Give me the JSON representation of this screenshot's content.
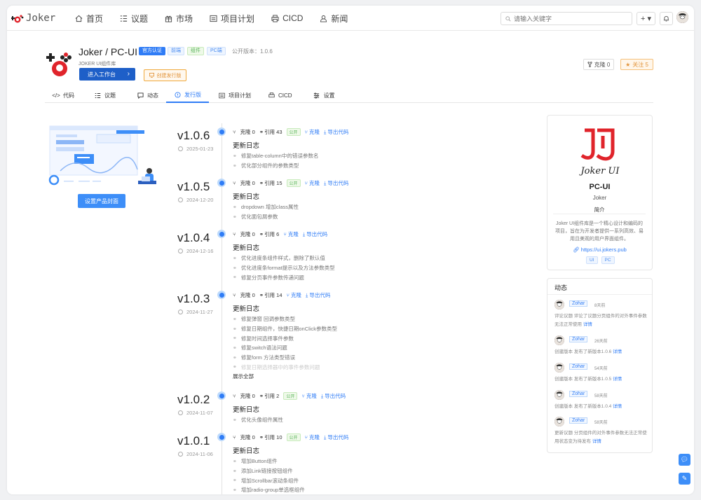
{
  "app": {
    "name": "Joker"
  },
  "nav": {
    "items": [
      {
        "label": "首页",
        "icon": "home-icon"
      },
      {
        "label": "议题",
        "icon": "list-icon"
      },
      {
        "label": "市场",
        "icon": "gift-icon"
      },
      {
        "label": "项目计划",
        "icon": "calendar-icon"
      },
      {
        "label": "CICD",
        "icon": "printer-icon"
      },
      {
        "label": "新闻",
        "icon": "user-icon"
      }
    ],
    "search_placeholder": "请输入关键字",
    "plus_label": "+ ▾"
  },
  "repo": {
    "owner": "Joker",
    "sep": " / ",
    "name": "PC-UI",
    "tags": [
      "官方认证",
      "前端",
      "组件",
      "PC端"
    ],
    "public_version": "公开版本：1.0.6",
    "subtitle": "JOKER UI组件库",
    "enter_label": "进入工作台",
    "create_release_label": "创建发行版",
    "clone_label": "克隆 0",
    "star_label": "关注 5"
  },
  "tabs": [
    {
      "label": "代码",
      "icon": "code-icon"
    },
    {
      "label": "议题",
      "icon": "list-icon"
    },
    {
      "label": "动态",
      "icon": "message-icon"
    },
    {
      "label": "发行版",
      "icon": "info-icon",
      "active": true
    },
    {
      "label": "项目计划",
      "icon": "calendar-icon"
    },
    {
      "label": "CICD",
      "icon": "printer-icon"
    },
    {
      "label": "设置",
      "icon": "sliders-icon"
    }
  ],
  "set_cover_label": "设置产品封面",
  "changelog_title": "更新日志",
  "show_all_label": "展示全部",
  "releases": [
    {
      "version": "v1.0.6",
      "date": "2025-01-23",
      "clone": "克隆 0",
      "refs": "引用 43",
      "public": "公开",
      "clone_link": "克隆",
      "export": "导出代码",
      "items": [
        "修复table-column中的错误参数名",
        "优化部分组件的参数类型"
      ]
    },
    {
      "version": "v1.0.5",
      "date": "2024-12-20",
      "clone": "克隆 0",
      "refs": "引用 15",
      "public": "公开",
      "clone_link": "克隆",
      "export": "导出代码",
      "items": [
        "dropdown 增加class属性",
        "优化面包屑参数"
      ]
    },
    {
      "version": "v1.0.4",
      "date": "2024-12-16",
      "clone": "克隆 0",
      "refs": "引用 6",
      "public": "",
      "clone_link": "克隆",
      "export": "导出代码",
      "items": [
        "优化进度条组件样式，删除了默认值",
        "优化进度条format提示以及方法参数类型",
        "修复分页事件参数传递问题"
      ]
    },
    {
      "version": "v1.0.3",
      "date": "2024-11-27",
      "clone": "克隆 0",
      "refs": "引用 14",
      "public": "",
      "clone_link": "克隆",
      "export": "导出代码",
      "items": [
        "修复弹窗 回调参数类型",
        "修复日期组件，快捷日期onClick参数类型",
        "修复时间选择事件参数",
        "修复switch语法问题",
        "修复form 方法类型错误",
        "修复日期选择器中的事件参数问题"
      ]
    },
    {
      "version": "v1.0.2",
      "date": "2024-11-07",
      "clone": "克隆 0",
      "refs": "引用 2",
      "public": "公开",
      "clone_link": "克隆",
      "export": "导出代码",
      "items": [
        "优化头像组件属性"
      ]
    },
    {
      "version": "v1.0.1",
      "date": "2024-11-06",
      "clone": "克隆 0",
      "refs": "引用 10",
      "public": "公开",
      "clone_link": "克隆",
      "export": "导出代码",
      "items": [
        "增加Button组件",
        "添加Link链接按钮组件",
        "增加Scrollbar滚动条组件",
        "增加radio-group单选框组件"
      ]
    }
  ],
  "product": {
    "logo_text": "Joker UI",
    "name": "PC-UI",
    "owner": "Joker",
    "section": "简介",
    "description": "Joker UI组件库是一个精心设计和编码的项目，旨在为开发者提供一系列高效、易用且美观的用户界面组件。",
    "url": "https://ui.jokers.pub",
    "tags": [
      "UI",
      "PC"
    ]
  },
  "activity": {
    "title": "动态",
    "events": [
      {
        "user": "Zohar",
        "ago": "8天前",
        "text": "评论议题 评论了议题分页组件的对外事件参数无法正常使用",
        "link": "详情"
      },
      {
        "user": "Zohar",
        "ago": "26天前",
        "text": "创建版本 发布了新版本1.0.6",
        "link": "详情"
      },
      {
        "user": "Zohar",
        "ago": "54天前",
        "text": "创建版本 发布了新版本1.0.5",
        "link": "详情"
      },
      {
        "user": "Zohar",
        "ago": "58天前",
        "text": "创建版本 发布了新版本1.0.4",
        "link": "详情"
      },
      {
        "user": "Zohar",
        "ago": "58天前",
        "text": "更新议题 分页组件的对外事件参数无法正常使用状态变为待发布",
        "link": "详情"
      }
    ]
  },
  "colors": {
    "accent": "#2f7cf6",
    "brand_red": "#e0242b",
    "green": "#5bb55c",
    "orange": "#e2943b"
  }
}
